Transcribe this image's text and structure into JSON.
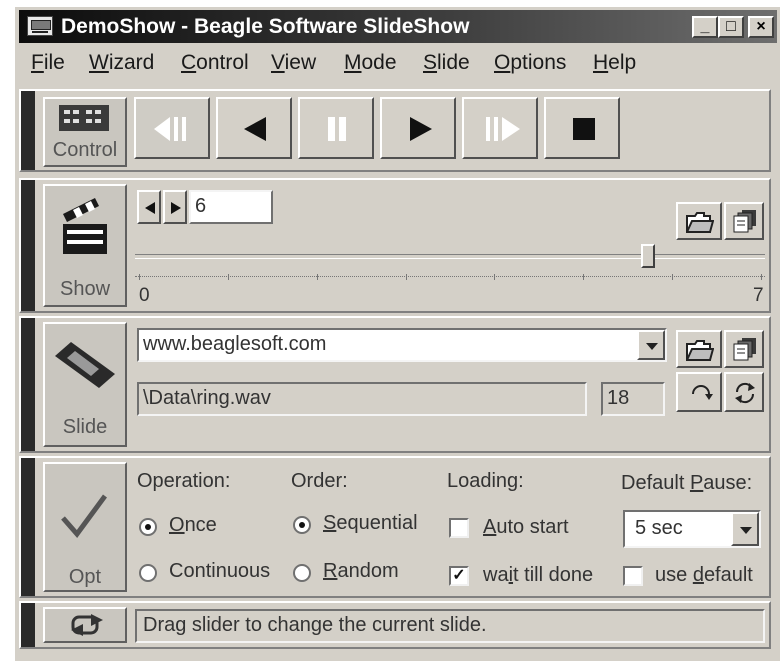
{
  "window": {
    "title": "DemoShow - Beagle Software SlideShow",
    "buttons": {
      "minimize": "_",
      "maximize": "□",
      "close": "×"
    }
  },
  "menu": [
    {
      "label": "File",
      "underline": "F"
    },
    {
      "label": "Wizard",
      "underline": "W"
    },
    {
      "label": "Control",
      "underline": "C"
    },
    {
      "label": "View",
      "underline": "V"
    },
    {
      "label": "Mode",
      "underline": "M"
    },
    {
      "label": "Slide",
      "underline": "S"
    },
    {
      "label": "Options",
      "underline": "O"
    },
    {
      "label": "Help",
      "underline": "H"
    }
  ],
  "control": {
    "label": "Control",
    "icons": [
      "first-slide-icon",
      "previous-icon",
      "pause-icon",
      "play-icon",
      "last-slide-icon",
      "stop-icon"
    ]
  },
  "show": {
    "label": "Show",
    "slide_number": "6",
    "slider_min": "0",
    "slider_max": "7",
    "slider_value": 6
  },
  "slide": {
    "label": "Slide",
    "url": "www.beaglesoft.com",
    "sound_file": "\\Data\\ring.wav",
    "duration": "18"
  },
  "opt": {
    "label": "Opt",
    "operation": {
      "heading": "Operation:",
      "options": [
        "Once",
        "Continuous"
      ],
      "selected": "Once"
    },
    "order": {
      "heading": "Order:",
      "options": [
        "Sequential",
        "Random"
      ],
      "selected": "Sequential"
    },
    "loading": {
      "heading": "Loading:",
      "auto_start": "Auto start",
      "auto_start_checked": false,
      "wait_till_done": "wait till done",
      "wait_till_done_checked": true
    },
    "default_pause": {
      "heading": "Default Pause:",
      "value": "5 sec",
      "use_default": "use default",
      "use_default_checked": false
    }
  },
  "status": {
    "text": "Drag slider to change the current slide."
  }
}
